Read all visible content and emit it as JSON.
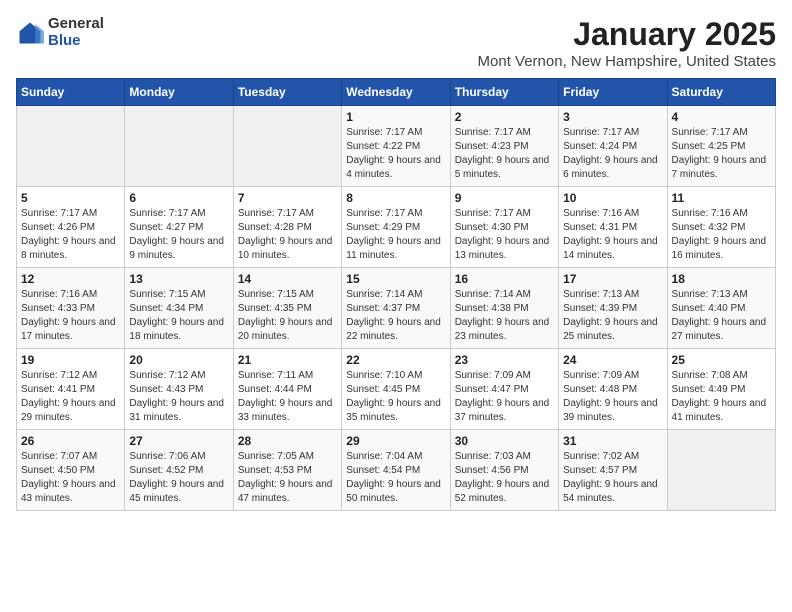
{
  "logo": {
    "general": "General",
    "blue": "Blue"
  },
  "title": "January 2025",
  "subtitle": "Mont Vernon, New Hampshire, United States",
  "days_of_week": [
    "Sunday",
    "Monday",
    "Tuesday",
    "Wednesday",
    "Thursday",
    "Friday",
    "Saturday"
  ],
  "weeks": [
    [
      {
        "day": "",
        "sunrise": "",
        "sunset": "",
        "daylight": "",
        "empty": true
      },
      {
        "day": "",
        "sunrise": "",
        "sunset": "",
        "daylight": "",
        "empty": true
      },
      {
        "day": "",
        "sunrise": "",
        "sunset": "",
        "daylight": "",
        "empty": true
      },
      {
        "day": "1",
        "sunrise": "Sunrise: 7:17 AM",
        "sunset": "Sunset: 4:22 PM",
        "daylight": "Daylight: 9 hours and 4 minutes."
      },
      {
        "day": "2",
        "sunrise": "Sunrise: 7:17 AM",
        "sunset": "Sunset: 4:23 PM",
        "daylight": "Daylight: 9 hours and 5 minutes."
      },
      {
        "day": "3",
        "sunrise": "Sunrise: 7:17 AM",
        "sunset": "Sunset: 4:24 PM",
        "daylight": "Daylight: 9 hours and 6 minutes."
      },
      {
        "day": "4",
        "sunrise": "Sunrise: 7:17 AM",
        "sunset": "Sunset: 4:25 PM",
        "daylight": "Daylight: 9 hours and 7 minutes."
      }
    ],
    [
      {
        "day": "5",
        "sunrise": "Sunrise: 7:17 AM",
        "sunset": "Sunset: 4:26 PM",
        "daylight": "Daylight: 9 hours and 8 minutes."
      },
      {
        "day": "6",
        "sunrise": "Sunrise: 7:17 AM",
        "sunset": "Sunset: 4:27 PM",
        "daylight": "Daylight: 9 hours and 9 minutes."
      },
      {
        "day": "7",
        "sunrise": "Sunrise: 7:17 AM",
        "sunset": "Sunset: 4:28 PM",
        "daylight": "Daylight: 9 hours and 10 minutes."
      },
      {
        "day": "8",
        "sunrise": "Sunrise: 7:17 AM",
        "sunset": "Sunset: 4:29 PM",
        "daylight": "Daylight: 9 hours and 11 minutes."
      },
      {
        "day": "9",
        "sunrise": "Sunrise: 7:17 AM",
        "sunset": "Sunset: 4:30 PM",
        "daylight": "Daylight: 9 hours and 13 minutes."
      },
      {
        "day": "10",
        "sunrise": "Sunrise: 7:16 AM",
        "sunset": "Sunset: 4:31 PM",
        "daylight": "Daylight: 9 hours and 14 minutes."
      },
      {
        "day": "11",
        "sunrise": "Sunrise: 7:16 AM",
        "sunset": "Sunset: 4:32 PM",
        "daylight": "Daylight: 9 hours and 16 minutes."
      }
    ],
    [
      {
        "day": "12",
        "sunrise": "Sunrise: 7:16 AM",
        "sunset": "Sunset: 4:33 PM",
        "daylight": "Daylight: 9 hours and 17 minutes."
      },
      {
        "day": "13",
        "sunrise": "Sunrise: 7:15 AM",
        "sunset": "Sunset: 4:34 PM",
        "daylight": "Daylight: 9 hours and 18 minutes."
      },
      {
        "day": "14",
        "sunrise": "Sunrise: 7:15 AM",
        "sunset": "Sunset: 4:35 PM",
        "daylight": "Daylight: 9 hours and 20 minutes."
      },
      {
        "day": "15",
        "sunrise": "Sunrise: 7:14 AM",
        "sunset": "Sunset: 4:37 PM",
        "daylight": "Daylight: 9 hours and 22 minutes."
      },
      {
        "day": "16",
        "sunrise": "Sunrise: 7:14 AM",
        "sunset": "Sunset: 4:38 PM",
        "daylight": "Daylight: 9 hours and 23 minutes."
      },
      {
        "day": "17",
        "sunrise": "Sunrise: 7:13 AM",
        "sunset": "Sunset: 4:39 PM",
        "daylight": "Daylight: 9 hours and 25 minutes."
      },
      {
        "day": "18",
        "sunrise": "Sunrise: 7:13 AM",
        "sunset": "Sunset: 4:40 PM",
        "daylight": "Daylight: 9 hours and 27 minutes."
      }
    ],
    [
      {
        "day": "19",
        "sunrise": "Sunrise: 7:12 AM",
        "sunset": "Sunset: 4:41 PM",
        "daylight": "Daylight: 9 hours and 29 minutes."
      },
      {
        "day": "20",
        "sunrise": "Sunrise: 7:12 AM",
        "sunset": "Sunset: 4:43 PM",
        "daylight": "Daylight: 9 hours and 31 minutes."
      },
      {
        "day": "21",
        "sunrise": "Sunrise: 7:11 AM",
        "sunset": "Sunset: 4:44 PM",
        "daylight": "Daylight: 9 hours and 33 minutes."
      },
      {
        "day": "22",
        "sunrise": "Sunrise: 7:10 AM",
        "sunset": "Sunset: 4:45 PM",
        "daylight": "Daylight: 9 hours and 35 minutes."
      },
      {
        "day": "23",
        "sunrise": "Sunrise: 7:09 AM",
        "sunset": "Sunset: 4:47 PM",
        "daylight": "Daylight: 9 hours and 37 minutes."
      },
      {
        "day": "24",
        "sunrise": "Sunrise: 7:09 AM",
        "sunset": "Sunset: 4:48 PM",
        "daylight": "Daylight: 9 hours and 39 minutes."
      },
      {
        "day": "25",
        "sunrise": "Sunrise: 7:08 AM",
        "sunset": "Sunset: 4:49 PM",
        "daylight": "Daylight: 9 hours and 41 minutes."
      }
    ],
    [
      {
        "day": "26",
        "sunrise": "Sunrise: 7:07 AM",
        "sunset": "Sunset: 4:50 PM",
        "daylight": "Daylight: 9 hours and 43 minutes."
      },
      {
        "day": "27",
        "sunrise": "Sunrise: 7:06 AM",
        "sunset": "Sunset: 4:52 PM",
        "daylight": "Daylight: 9 hours and 45 minutes."
      },
      {
        "day": "28",
        "sunrise": "Sunrise: 7:05 AM",
        "sunset": "Sunset: 4:53 PM",
        "daylight": "Daylight: 9 hours and 47 minutes."
      },
      {
        "day": "29",
        "sunrise": "Sunrise: 7:04 AM",
        "sunset": "Sunset: 4:54 PM",
        "daylight": "Daylight: 9 hours and 50 minutes."
      },
      {
        "day": "30",
        "sunrise": "Sunrise: 7:03 AM",
        "sunset": "Sunset: 4:56 PM",
        "daylight": "Daylight: 9 hours and 52 minutes."
      },
      {
        "day": "31",
        "sunrise": "Sunrise: 7:02 AM",
        "sunset": "Sunset: 4:57 PM",
        "daylight": "Daylight: 9 hours and 54 minutes."
      },
      {
        "day": "",
        "sunrise": "",
        "sunset": "",
        "daylight": "",
        "empty": true
      }
    ]
  ]
}
